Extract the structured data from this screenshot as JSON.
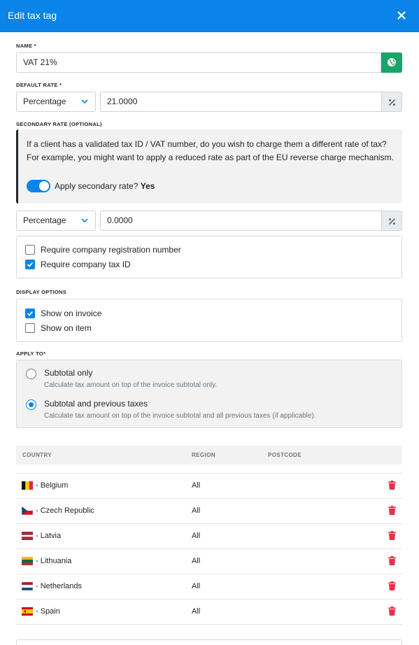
{
  "header": {
    "title": "Edit tax tag"
  },
  "name_field": {
    "label": "NAME *",
    "value": "VAT 21%"
  },
  "default_rate": {
    "label": "DEFAULT RATE *",
    "type": "Percentage",
    "value": "21.0000"
  },
  "secondary_rate": {
    "label": "SECONDARY RATE (OPTIONAL)",
    "info": "If a client has a validated tax ID / VAT number, do you wish to charge them a different rate of tax? For example, you might want to apply a reduced rate as part of the EU reverse charge mechanism.",
    "toggle_label": "Apply secondary rate?",
    "toggle_value": "Yes",
    "type": "Percentage",
    "value": "0.0000",
    "checks": [
      {
        "label": "Require company registration number",
        "checked": false
      },
      {
        "label": "Require company tax ID",
        "checked": true
      }
    ]
  },
  "display_options": {
    "label": "DISPLAY OPTIONS",
    "checks": [
      {
        "label": "Show on invoice",
        "checked": true
      },
      {
        "label": "Show on item",
        "checked": false
      }
    ]
  },
  "apply_to": {
    "label": "APPLY TO*",
    "options": [
      {
        "title": "Subtotal only",
        "desc": "Calculate tax amount on top of the invoice subtotal only.",
        "selected": false
      },
      {
        "title": "Subtotal and previous taxes",
        "desc": "Calculate tax amount on top of the invoice subtotal and all previous taxes (if applicable).",
        "selected": true
      }
    ]
  },
  "table": {
    "columns": [
      "COUNTRY",
      "REGION",
      "POSTCODE"
    ],
    "rows": [
      {
        "country": "- Belgium",
        "region": "All",
        "flag": "belgium-flag-icon"
      },
      {
        "country": "- Czech Republic",
        "region": "All",
        "flag": "czech-flag-icon"
      },
      {
        "country": "- Latvia",
        "region": "All",
        "flag": "latvia-flag-icon"
      },
      {
        "country": "- Lithuania",
        "region": "All",
        "flag": "lithuania-flag-icon"
      },
      {
        "country": "- Netherlands",
        "region": "All",
        "flag": "netherlands-flag-icon"
      },
      {
        "country": "- Spain",
        "region": "All",
        "flag": "spain-flag-icon"
      }
    ]
  },
  "colors": {
    "primary": "#0a84e8",
    "success": "#1aa36a",
    "danger": "#e8304a"
  }
}
